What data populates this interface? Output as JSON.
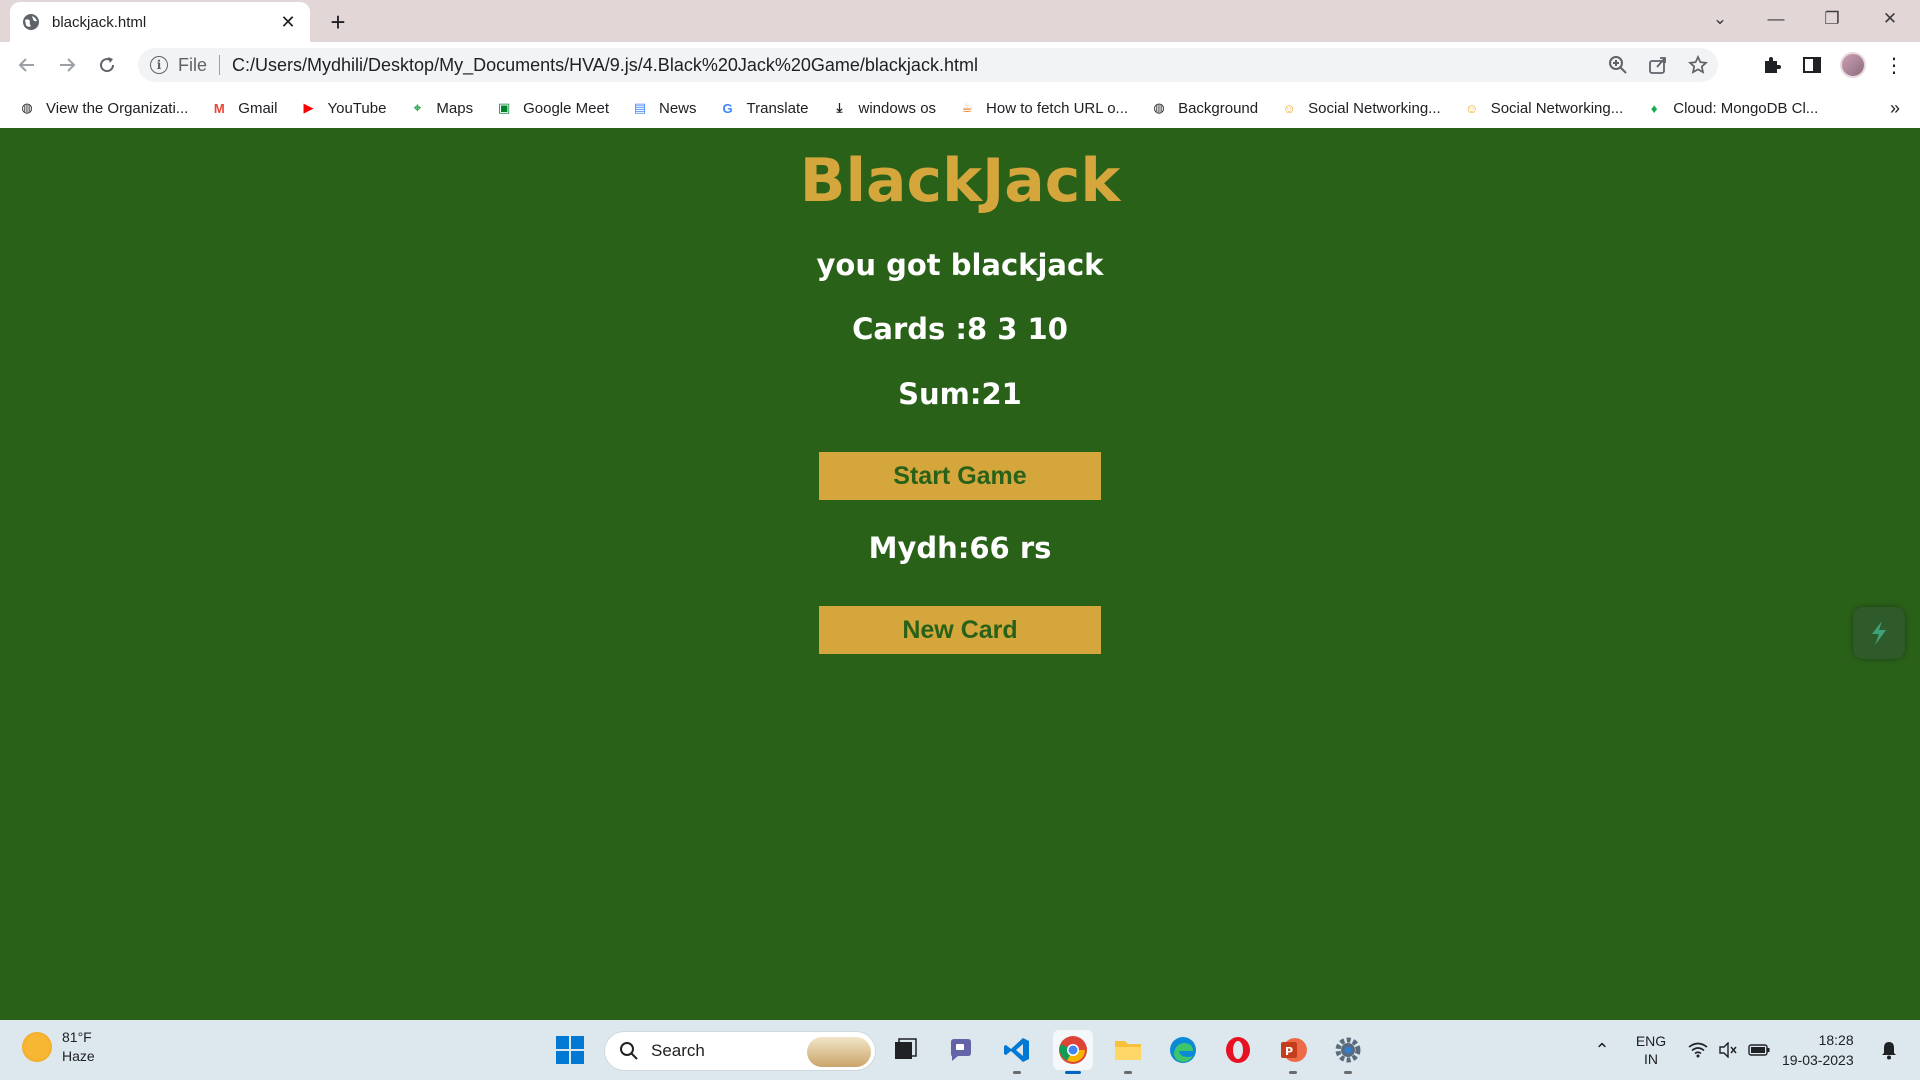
{
  "browser": {
    "tab_title": "blackjack.html",
    "new_tab_symbol": "+",
    "address_scheme": "File",
    "address_url": "C:/Users/Mydhili/Desktop/My_Documents/HVA/9.js/4.Black%20Jack%20Game/blackjack.html"
  },
  "bookmarks": [
    {
      "label": "View the Organizati...",
      "icon": "globe-icon",
      "color": "#202124"
    },
    {
      "label": "Gmail",
      "icon": "gmail-icon",
      "color": "#ea4335"
    },
    {
      "label": "YouTube",
      "icon": "youtube-icon",
      "color": "#ff0000"
    },
    {
      "label": "Maps",
      "icon": "maps-icon",
      "color": "#34a853"
    },
    {
      "label": "Google Meet",
      "icon": "meet-icon",
      "color": "#00832d"
    },
    {
      "label": "News",
      "icon": "news-icon",
      "color": "#4285f4"
    },
    {
      "label": "Translate",
      "icon": "translate-icon",
      "color": "#4285f4"
    },
    {
      "label": "windows os",
      "icon": "download-icon",
      "color": "#202124"
    },
    {
      "label": "How to fetch URL o...",
      "icon": "java-icon",
      "color": "#e76f00"
    },
    {
      "label": "Background",
      "icon": "globe-icon",
      "color": "#202124"
    },
    {
      "label": "Social Networking...",
      "icon": "social-icon",
      "color": "#f5a623"
    },
    {
      "label": "Social Networking...",
      "icon": "social-icon",
      "color": "#f5a623"
    },
    {
      "label": "Cloud: MongoDB Cl...",
      "icon": "mongodb-icon",
      "color": "#13aa52"
    }
  ],
  "bookmarks_more": "»",
  "game": {
    "title": "BlackJack",
    "message": "you got blackjack",
    "cards_text": "Cards :8 3 10",
    "sum_text": "Sum:21",
    "start_button": "Start Game",
    "player_text": "Mydh:66 rs",
    "new_card_button": "New Card"
  },
  "colors": {
    "background": "#2a6119",
    "accent": "#d4a63c",
    "text": "#ffffff"
  },
  "taskbar": {
    "weather_temp": "81°F",
    "weather_desc": "Haze",
    "search_label": "Search",
    "lang_line1": "ENG",
    "lang_line2": "IN",
    "time": "18:28",
    "date": "19-03-2023"
  }
}
